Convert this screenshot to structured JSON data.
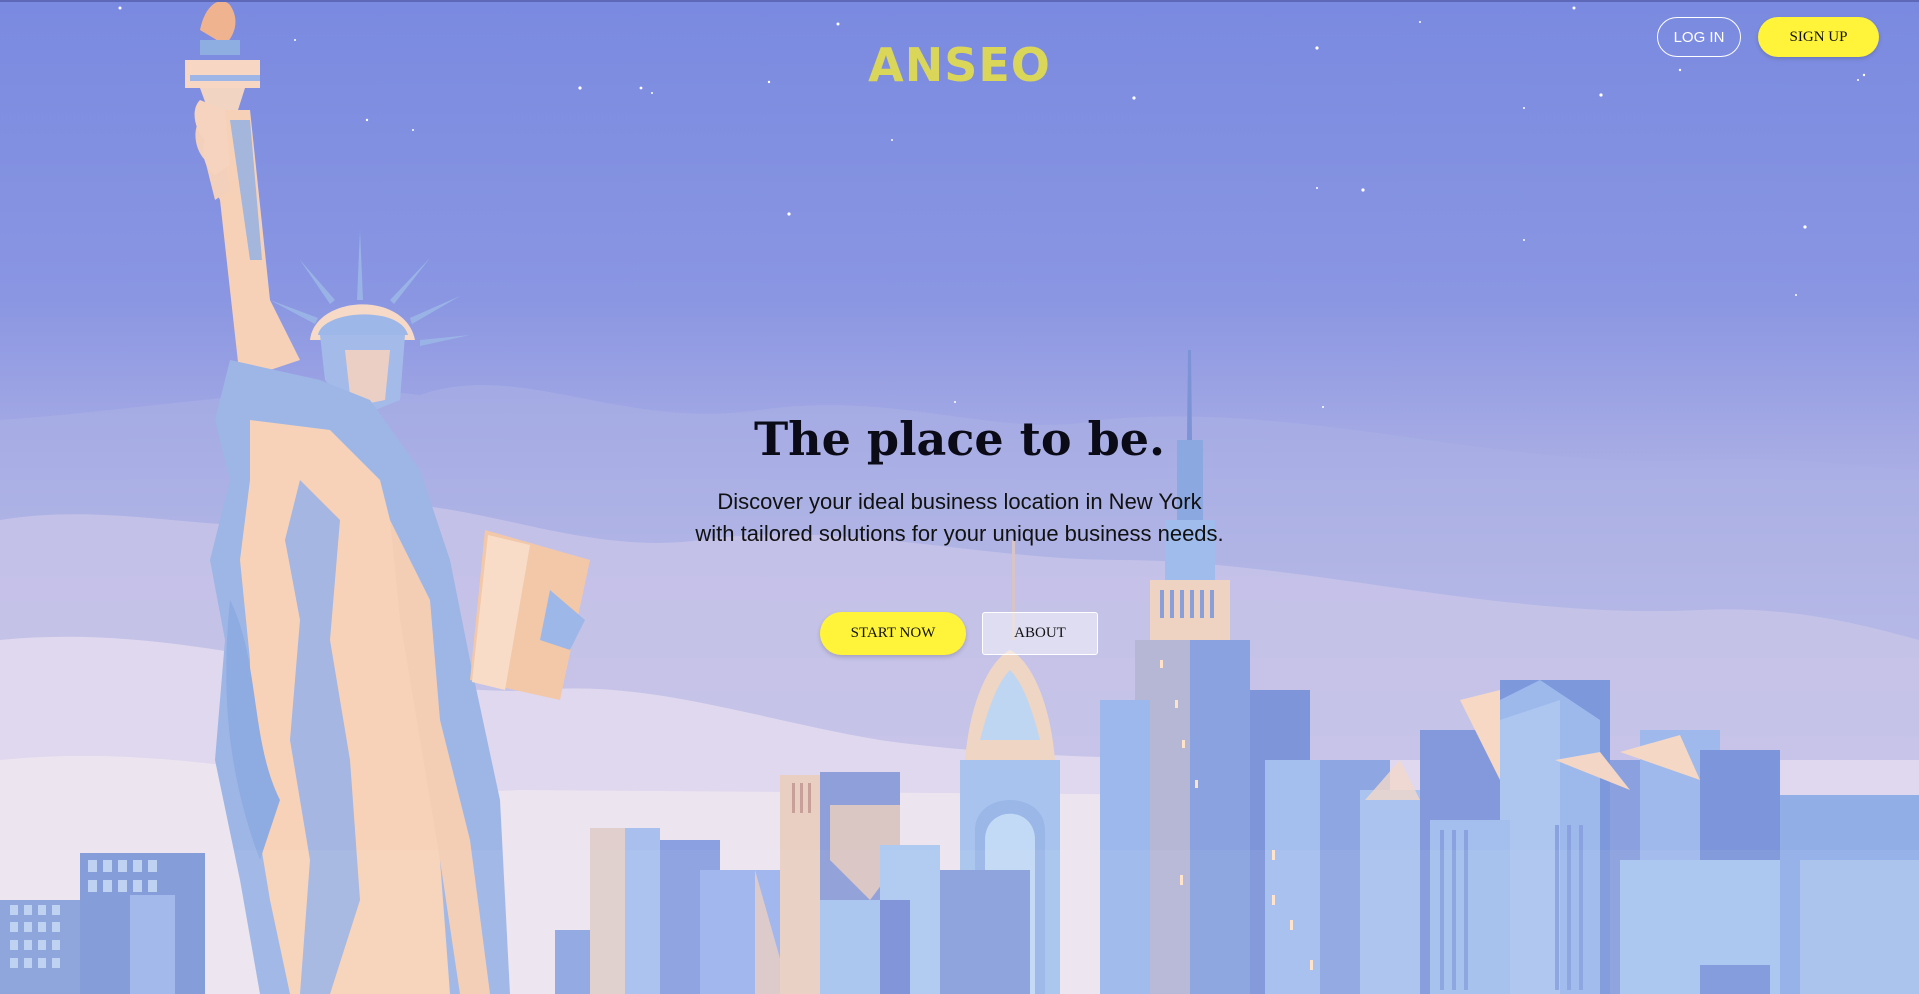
{
  "brand": {
    "logo_text": "ANSEO"
  },
  "nav": {
    "login_label": "LOG IN",
    "signup_label": "SIGN UP"
  },
  "hero": {
    "title": "The place to be.",
    "subtitle_line1": "Discover your ideal business location in New York",
    "subtitle_line2": "with tailored solutions for your unique business needs.",
    "start_label": "START NOW",
    "about_label": "ABOUT"
  },
  "colors": {
    "sky": "#7a8ae0",
    "accent_yellow": "#fff43a",
    "logo_yellow": "#d9d65a",
    "statue_skin": "#f8d2b8",
    "statue_shadow": "#8fa8e0"
  }
}
